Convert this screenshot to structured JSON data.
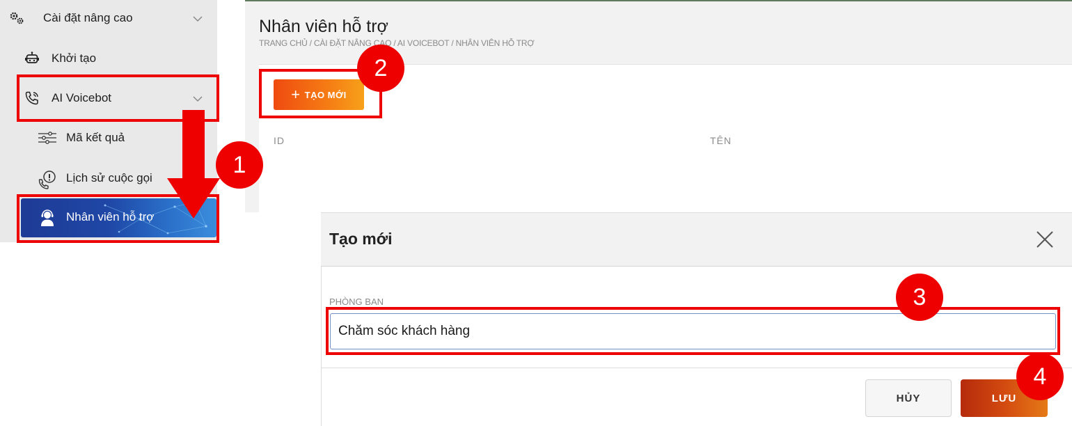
{
  "sidebar": {
    "advanced_settings": {
      "label": "Cài đặt nâng cao",
      "icon": "gears-icon"
    },
    "items": [
      {
        "label": "Khởi tạo",
        "icon": "robot-icon"
      },
      {
        "label": "AI Voicebot",
        "icon": "phone-call-icon"
      },
      {
        "label": "Mã kết quả",
        "icon": "sliders-icon"
      },
      {
        "label": "Lịch sử cuộc gọi",
        "icon": "phone-info-icon"
      },
      {
        "label": "Nhân viên hỗ trợ",
        "icon": "support-agent-icon",
        "active": true
      }
    ]
  },
  "page": {
    "title": "Nhân viên hỗ trợ",
    "breadcrumb": "TRANG CHỦ / CÀI ĐẶT NÂNG CAO / AI VOICEBOT / NHÂN VIÊN HỖ TRỢ",
    "create_button": "TẠO MỚI",
    "columns": [
      "ID",
      "TÊN"
    ]
  },
  "modal": {
    "title": "Tạo mới",
    "field_label": "PHÒNG BAN",
    "field_value": "Chăm sóc khách hàng",
    "cancel": "HỦY",
    "save": "LƯU"
  },
  "annotations": {
    "steps": [
      "1",
      "2",
      "3",
      "4"
    ],
    "color": "#ee0000"
  },
  "colors": {
    "active_nav": "#1f47a6",
    "primary_orange": "#f57c14",
    "highlight": "#ee0000"
  }
}
